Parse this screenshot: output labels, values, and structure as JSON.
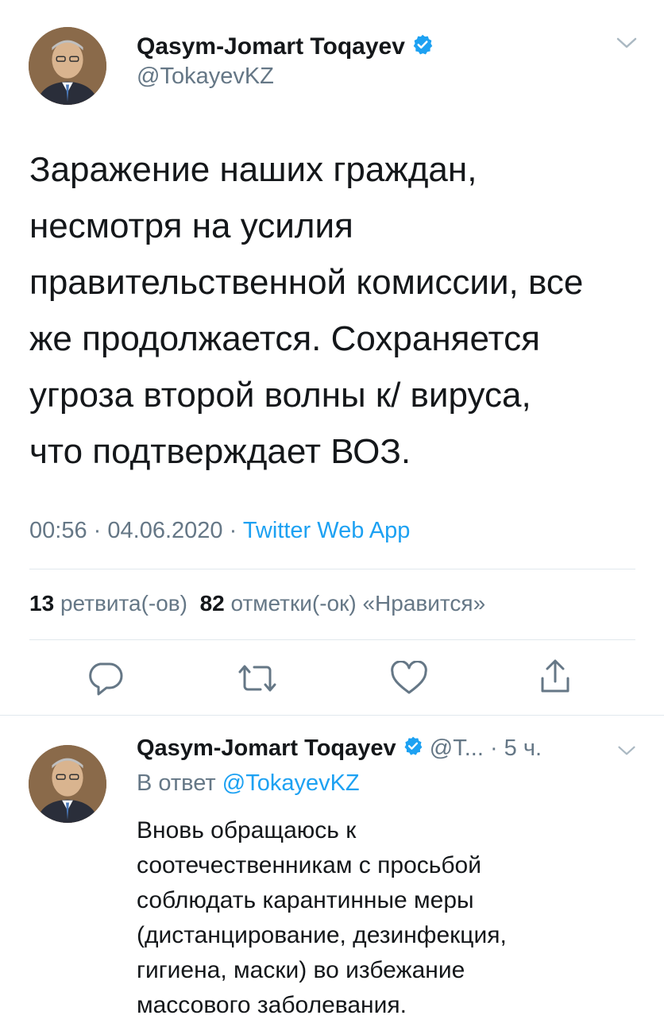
{
  "main_tweet": {
    "author_name": "Qasym-Jomart Toqayev",
    "handle": "@TokayevKZ",
    "text_lines": [
      "Заражение наших граждан,",
      "несмотря на усилия",
      "правительственной комиссии, все",
      "же продолжается. Сохраняется",
      "угроза второй волны к/ вируса,",
      "что подтверждает ВОЗ."
    ],
    "time": "00:56",
    "sep": "·",
    "date": "04.06.2020",
    "client": "Twitter Web App",
    "retweets_count": "13",
    "retweets_label": "ретвита(-ов)",
    "likes_count": "82",
    "likes_label": "отметки(-ок) «Нравится»"
  },
  "reply_tweet": {
    "author_name": "Qasym-Jomart Toqayev",
    "handle_truncated": "@T...",
    "time_ago": "· 5 ч.",
    "reply_prefix": "В ответ",
    "reply_to": "@TokayevKZ",
    "text_lines": [
      "Вновь обращаюсь к",
      "соотечественникам с просьбой",
      "соблюдать карантинные меры",
      "(дистанцирование, дезинфекция,",
      "гигиена, маски) во избежание",
      "массового заболевания."
    ]
  },
  "colors": {
    "accent": "#1da1f2",
    "secondary_text": "#657786",
    "divider": "#e1e8ed"
  },
  "icons": [
    "verified-badge-icon",
    "chevron-down-icon",
    "reply-icon",
    "retweet-icon",
    "like-icon",
    "share-icon"
  ]
}
